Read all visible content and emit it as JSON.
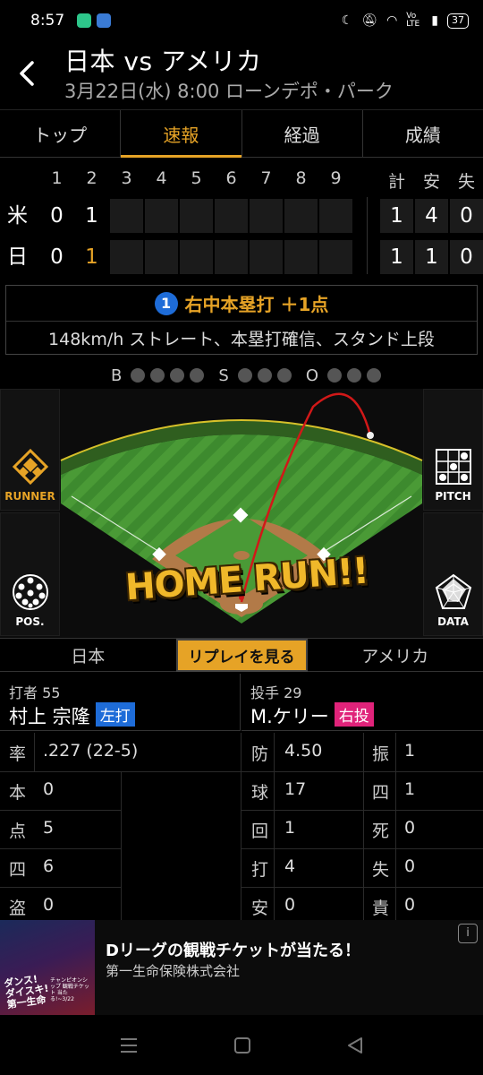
{
  "status_bar": {
    "time": "8:57",
    "battery": "37",
    "network": "Vo LTE"
  },
  "header": {
    "title": "日本 vs アメリカ",
    "subtitle": "3月22日(水) 8:00 ローンデポ・パーク"
  },
  "tabs": [
    {
      "label": "トップ",
      "active": false
    },
    {
      "label": "速報",
      "active": true
    },
    {
      "label": "経過",
      "active": false
    },
    {
      "label": "成績",
      "active": false
    }
  ],
  "scoreboard": {
    "innings": [
      "1",
      "2",
      "3",
      "4",
      "5",
      "6",
      "7",
      "8",
      "9"
    ],
    "totals_headers": [
      "計",
      "安",
      "失"
    ],
    "teams": [
      {
        "name": "米",
        "innings": [
          "0",
          "1",
          "",
          "",
          "",
          "",
          "",
          "",
          ""
        ],
        "totals": [
          "1",
          "4",
          "0"
        ]
      },
      {
        "name": "日",
        "innings": [
          "0",
          "1",
          "",
          "",
          "",
          "",
          "",
          "",
          ""
        ],
        "totals": [
          "1",
          "1",
          "0"
        ]
      }
    ]
  },
  "play": {
    "number": "1",
    "result": "右中本塁打 ＋1点",
    "detail": "148km/h ストレート、本塁打確信、スタンド上段"
  },
  "count": {
    "b_label": "B",
    "s_label": "S",
    "o_label": "O",
    "balls": 0,
    "strikes": 0,
    "outs": 0
  },
  "field": {
    "banner": "HOME RUN!!",
    "buttons": {
      "runner": "RUNNER",
      "pos": "POS.",
      "pitch": "PITCH",
      "data": "DATA"
    }
  },
  "replay_row": {
    "home": "日本",
    "away": "アメリカ",
    "replay_label": "リプレイを見る"
  },
  "batter": {
    "role": "打者",
    "number": "55",
    "name": "村上 宗隆",
    "badge": "左打",
    "stats": [
      {
        "k": "率",
        "v": ".227 (22-5)"
      },
      {
        "k": "本",
        "v": "0"
      },
      {
        "k": "点",
        "v": "5"
      },
      {
        "k": "四",
        "v": "6"
      },
      {
        "k": "盗",
        "v": "0"
      }
    ]
  },
  "pitcher": {
    "role": "投手",
    "number": "29",
    "name": "M.ケリー",
    "badge": "右投",
    "stats_left": [
      {
        "k": "防",
        "v": "4.50"
      },
      {
        "k": "球",
        "v": "17"
      },
      {
        "k": "回",
        "v": "1"
      },
      {
        "k": "打",
        "v": "4"
      },
      {
        "k": "安",
        "v": "0"
      }
    ],
    "stats_right": [
      {
        "k": "振",
        "v": "1"
      },
      {
        "k": "四",
        "v": "1"
      },
      {
        "k": "死",
        "v": "0"
      },
      {
        "k": "失",
        "v": "0"
      },
      {
        "k": "責",
        "v": "0"
      }
    ]
  },
  "ad": {
    "headline": "Dリーグの観戦チケットが当たる！",
    "sponsor": "第一生命保険株式会社",
    "image_text": "ダンス! ダイスキ! 第一生命",
    "image_subtext": "チャンピオンシップ 観戦チケット 当たる!~3/22",
    "info_icon": "i"
  },
  "colors": {
    "accent": "#e6a326",
    "blue_badge": "#1e6cd8",
    "pink_badge": "#e0237a",
    "turf": "#3d8a2e"
  }
}
